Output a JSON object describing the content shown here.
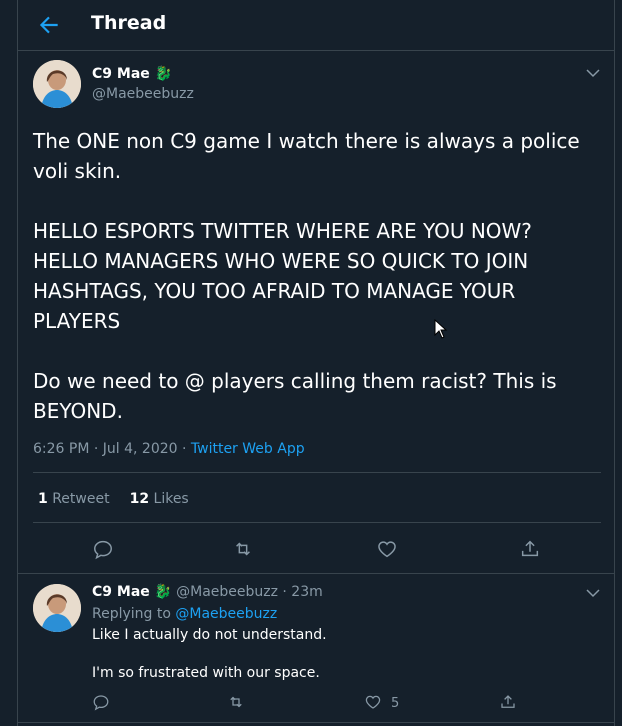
{
  "header": {
    "title": "Thread"
  },
  "tweet": {
    "display_name": "C9 Mae",
    "emoji": "🐉",
    "handle": "@Maebeebuzz",
    "text": "The ONE non C9 game I watch there is always a police\nvoli skin.\n\nHELLO ESPORTS TWITTER WHERE ARE YOU NOW?\nHELLO MANAGERS WHO WERE SO QUICK TO JOIN\nHASHTAGS, YOU TOO AFRAID TO MANAGE YOUR\nPLAYERS\n\nDo we need to @ players calling them racist? This is\nBEYOND.",
    "timestamp": "6:26 PM · Jul 4, 2020 · ",
    "source": "Twitter Web App",
    "retweets_count": "1",
    "retweets_label": "Retweet",
    "likes_count": "12",
    "likes_label": "Likes"
  },
  "reply": {
    "display_name": "C9 Mae",
    "emoji": "🐉",
    "handle_time": "@Maebeebuzz · 23m",
    "replying_prefix": "Replying to ",
    "replying_to": "@Maebeebuzz",
    "text": "Like I actually do not understand.\n\nI'm so frustrated with our space.",
    "likes_count": "5"
  },
  "colors": {
    "background": "#15202b",
    "accent": "#1da1f2",
    "muted": "#8899a6",
    "border": "#38444d"
  },
  "icons": [
    "back-arrow-icon",
    "chevron-down-icon",
    "reply-icon",
    "retweet-icon",
    "like-icon",
    "share-icon"
  ]
}
